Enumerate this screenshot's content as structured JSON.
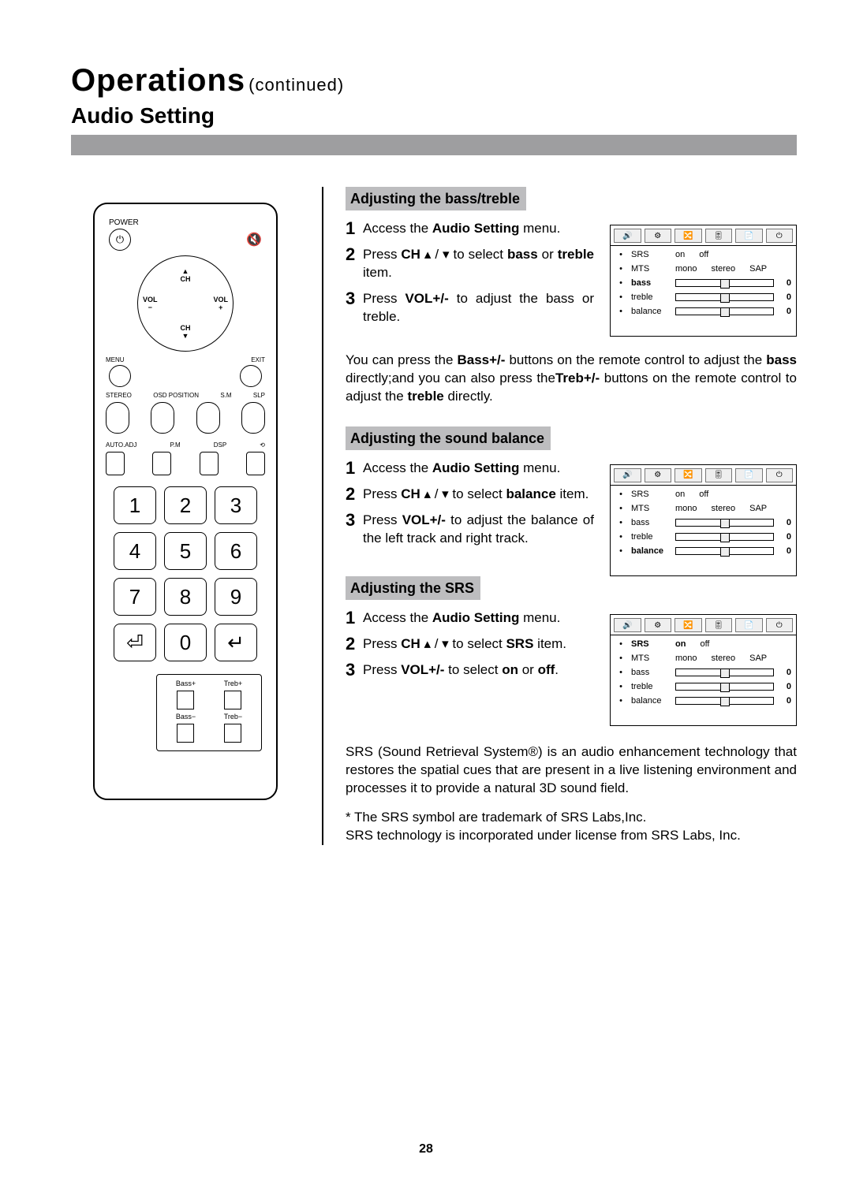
{
  "header": {
    "title": "Operations",
    "cont": "(continued)",
    "subtitle": "Audio Setting"
  },
  "page_number": "28",
  "remote": {
    "power": "POWER",
    "mute": "🔇",
    "ch": "CH",
    "vol_minus": "VOL\n−",
    "vol_plus": "VOL\n+",
    "menu": "MENU",
    "exit": "EXIT",
    "row1": [
      "STEREO",
      "OSD\nPOSITION",
      "S.M",
      "SLP"
    ],
    "row2": [
      "AUTO.ADJ",
      "P.M",
      "DSP",
      "⟲"
    ],
    "keys": [
      "1",
      "2",
      "3",
      "4",
      "5",
      "6",
      "7",
      "8",
      "9",
      "⏎",
      "0",
      "↵"
    ],
    "tone": {
      "bp": "Bass+",
      "tp": "Treb+",
      "bm": "Bass−",
      "tm": "Treb−"
    }
  },
  "sections": [
    {
      "heading": "Adjusting the bass/treble",
      "osd_highlight": "bass",
      "steps": [
        {
          "n": "1",
          "pre": "Access the ",
          "b1": "Audio Setting",
          "post": " menu."
        },
        {
          "n": "2",
          "pre": "Press  ",
          "b1": "CH",
          "mid": " ▴ / ▾ to select ",
          "b2": "bass",
          "post2": " or ",
          "b3": "treble",
          "tail": "  item."
        },
        {
          "n": "3",
          "pre": "Press   ",
          "b1": "VOL+/-",
          "post": "   to   adjust   the bass or treble."
        }
      ],
      "note": "You can press the <b>Bass+/-</b> buttons on the remote control to adjust the <b>bass</b> directly;and you can also press the<b>Treb+/-</b> buttons on the remote control to adjust the <b>treble</b> directly."
    },
    {
      "heading": "Adjusting the sound balance",
      "osd_highlight": "balance",
      "steps": [
        {
          "n": "1",
          "pre": "Access the ",
          "b1": "Audio Setting",
          "post": " menu."
        },
        {
          "n": "2",
          "pre": "Press  ",
          "b1": "CH",
          "mid": " ▴ / ▾ to select  ",
          "b2": "balance",
          "tail": " item."
        },
        {
          "n": "3",
          "pre": "Press   ",
          "b1": "VOL+/-",
          "post": "   to   adjust   the balance of the left track and right track."
        }
      ]
    },
    {
      "heading": "Adjusting the SRS",
      "osd_highlight": "SRS",
      "steps": [
        {
          "n": "1",
          "pre": "Access the ",
          "b1": "Audio Setting",
          "post": " menu."
        },
        {
          "n": "2",
          "pre": "Press  ",
          "b1": "CH",
          "mid": " ▴ / ▾  to select  ",
          "b2": "SRS",
          "tail": " item."
        },
        {
          "n": "3",
          "pre": "Press  ",
          "b1": "VOL+/-",
          "mid": "  to  select ",
          "b2": "on",
          "post2": " or ",
          "b3": "off",
          "tail": "."
        }
      ],
      "footer": "SRS (Sound Retrieval System®) is an audio enhancement technology that restores the spatial cues that are present in a live listening environment and processes it to provide a natural 3D sound field.",
      "star": "* The SRS symbol are trademark of SRS Labs,Inc.\n  SRS technology is incorporated under license from SRS Labs, Inc."
    }
  ],
  "osd": {
    "tabs": [
      "🔊",
      "⚙",
      "🔀",
      "🎚",
      "📄",
      "⏻"
    ],
    "rows": [
      {
        "key": "SRS",
        "type": "opts",
        "opts": [
          "on",
          "off"
        ]
      },
      {
        "key": "MTS",
        "type": "opts",
        "opts": [
          "mono",
          "stereo",
          "SAP"
        ]
      },
      {
        "key": "bass",
        "type": "slider",
        "val": "0"
      },
      {
        "key": "treble",
        "type": "slider",
        "val": "0"
      },
      {
        "key": "balance",
        "type": "slider",
        "val": "0"
      }
    ]
  }
}
